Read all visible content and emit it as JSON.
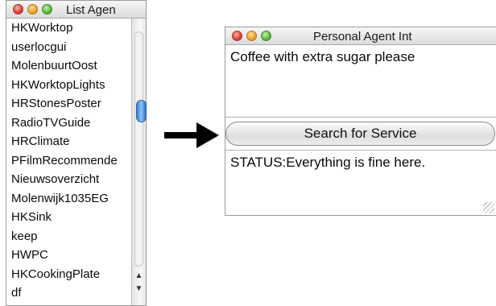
{
  "left_window": {
    "title": "List Agen",
    "items": [
      "HKWorktop",
      "userlocgui",
      "MolenbuurtOost",
      "HKWorktopLights",
      "HRStonesPoster",
      "RadioTVGuide",
      "HRClimate",
      "PFilmRecommende",
      "Nieuwsoverzicht",
      "Molenwijk1035EG",
      "HKSink",
      "keep",
      "HWPC",
      "HKCookingPlate",
      "df"
    ],
    "scroll_up_glyph": "▲",
    "scroll_down_glyph": "▼"
  },
  "right_window": {
    "title": "Personal Agent Int",
    "request_text": "Coffee with extra sugar please",
    "button_label": "Search for Service",
    "status_text": "STATUS:Everything is fine here."
  },
  "colors": {
    "thumb": "#3a7ed8",
    "close": "#e0443a",
    "minimize": "#f3a72a",
    "zoom": "#5dbd3f"
  },
  "icons": {
    "flow_arrow": "right-arrow-icon",
    "resize": "resize-grip-icon"
  }
}
